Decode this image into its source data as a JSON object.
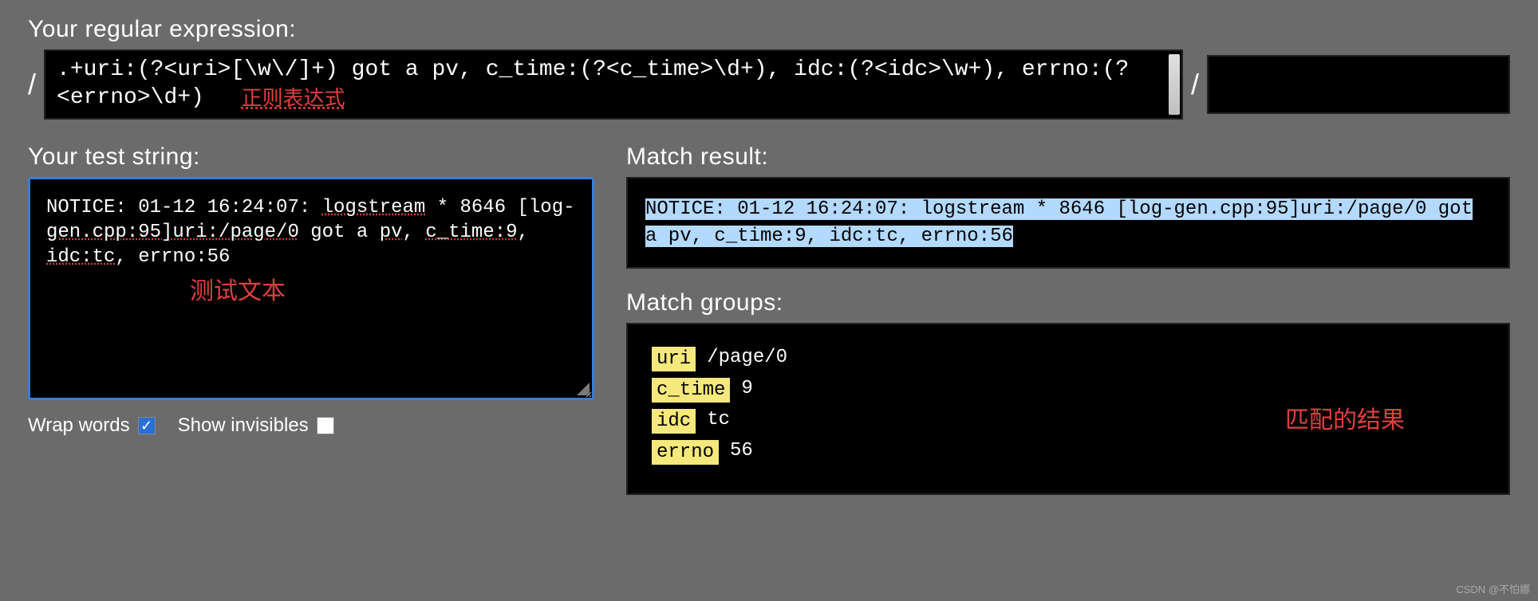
{
  "regex": {
    "label": "Your regular expression:",
    "pattern": ".+uri:(?<uri>[\\w\\/]+) got a pv, c_time:(?<c_time>\\d+), idc:(?<idc>\\w+), errno:(?<errno>\\d+)",
    "annotation": "正则表达式",
    "slash": "/"
  },
  "test": {
    "label": "Your test string:",
    "text_part1": "NOTICE: 01-12 16:24:07:  ",
    "text_part2": "logstream",
    "text_part3": " * 8646 [log-",
    "text_part4": "gen.cpp:95]uri:/page/0",
    "text_part5": " got a ",
    "text_part6": "pv",
    "text_part7": ", ",
    "text_part8": "c_time:9",
    "text_part9": ", ",
    "text_part10": "idc:tc",
    "text_part11": ", errno:56",
    "annotation": "测试文本"
  },
  "options": {
    "wrap_words": {
      "label": "Wrap words",
      "checked": true
    },
    "show_invisibles": {
      "label": "Show invisibles",
      "checked": false
    }
  },
  "result": {
    "label": "Match result:",
    "text": "NOTICE: 01-12 16:24:07:  logstream * 8646 [log-gen.cpp:95]uri:/page/0 got a pv, c_time:9, idc:tc, errno:56"
  },
  "groups": {
    "label": "Match groups:",
    "items": [
      {
        "name": "uri",
        "value": "/page/0"
      },
      {
        "name": "c_time",
        "value": "9"
      },
      {
        "name": "idc",
        "value": "tc"
      },
      {
        "name": "errno",
        "value": "56"
      }
    ],
    "annotation": "匹配的结果"
  },
  "watermark": "CSDN @不怕娜"
}
